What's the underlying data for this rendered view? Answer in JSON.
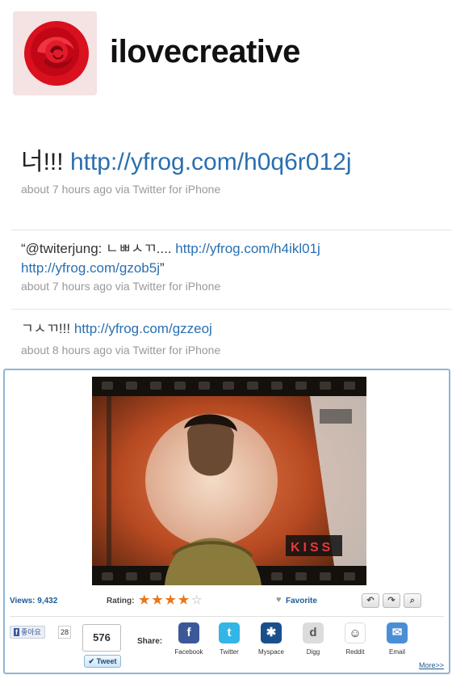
{
  "profile": {
    "username": "ilovecreative"
  },
  "tweets": [
    {
      "prefix": "너!!! ",
      "link": "http://yfrog.com/h0q6r012j",
      "meta": "about 7 hours ago via Twitter for iPhone"
    },
    {
      "prefix": "“@twiterjung:            ㄴㅃㅅㄲ.... ",
      "link": "http://yfrog.com/h4ikl01j",
      "link2": "http://yfrog.com/gzob5j",
      "suffix": "”",
      "meta": "about 7 hours ago via Twitter for iPhone"
    },
    {
      "prefix": "ㄱㅅㄲ!!! ",
      "link": "http://yfrog.com/gzzeoj",
      "meta": "about 8 hours ago via Twitter for iPhone"
    }
  ],
  "widget": {
    "views_label": "Views: 9,432",
    "rating_label": "Rating:",
    "rating_value": 4,
    "rating_max": 5,
    "favorite_label": "Favorite",
    "fb_like_label": "좋아요",
    "fb_like_count": "28",
    "tweet_count": "576",
    "tweet_button_label": "Tweet",
    "share_label": "Share:",
    "share_items": [
      "Facebook",
      "Twitter",
      "Myspace",
      "Digg",
      "Reddit",
      "Email"
    ],
    "more_label": "More>>",
    "video_badge": "KISS"
  },
  "colors": {
    "link": "#2a6fb0",
    "accent": "#e8761a",
    "widget_border": "#8fb4d6"
  }
}
